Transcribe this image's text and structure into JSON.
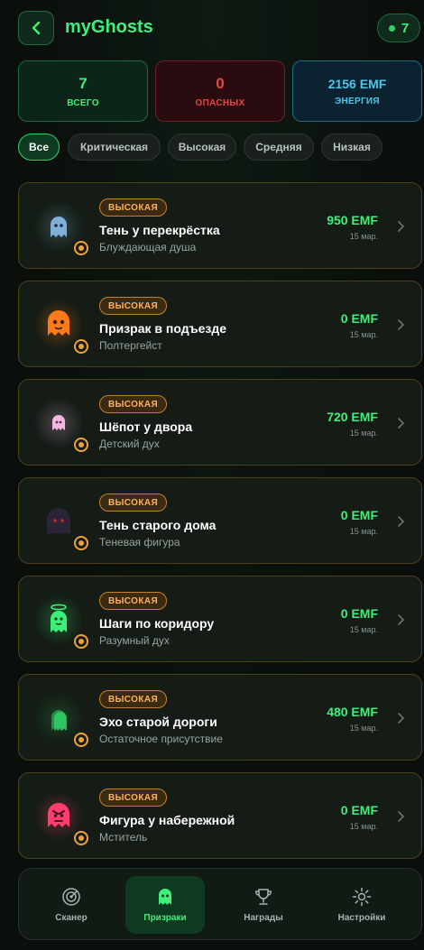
{
  "header": {
    "back_icon": "chevron-left-icon",
    "title": "myGhosts",
    "count": "7"
  },
  "stats": {
    "total": {
      "value": "7",
      "label": "ВСЕГО"
    },
    "danger": {
      "value": "0",
      "label": "ОПАСНЫХ"
    },
    "energy": {
      "value": "2156 EMF",
      "label": "ЭНЕРГИЯ"
    }
  },
  "filters": [
    "Все",
    "Критическая",
    "Высокая",
    "Средняя",
    "Низкая"
  ],
  "active_filter": "Все",
  "ghosts": [
    {
      "badge": "ВЫСОКАЯ",
      "title": "Тень у перекрёстка",
      "type": "Блуждающая душа",
      "emf": "950 EMF",
      "date": "15 мар.",
      "color": "#7fb0d8"
    },
    {
      "badge": "ВЫСОКАЯ",
      "title": "Призрак в подъезде",
      "type": "Полтергейст",
      "emf": "0 EMF",
      "date": "15 мар.",
      "color": "#ff7a1a"
    },
    {
      "badge": "ВЫСОКАЯ",
      "title": "Шёпот у двора",
      "type": "Детский дух",
      "emf": "720 EMF",
      "date": "15 мар.",
      "color": "#f2b8e0"
    },
    {
      "badge": "ВЫСОКАЯ",
      "title": "Тень старого дома",
      "type": "Теневая фигура",
      "emf": "0 EMF",
      "date": "15 мар.",
      "color": "#2a2436"
    },
    {
      "badge": "ВЫСОКАЯ",
      "title": "Шаги по коридору",
      "type": "Разумный дух",
      "emf": "0 EMF",
      "date": "15 мар.",
      "color": "#3ef07a"
    },
    {
      "badge": "ВЫСОКАЯ",
      "title": "Эхо старой дороги",
      "type": "Остаточное присутствие",
      "emf": "480 EMF",
      "date": "15 мар.",
      "color": "#2fd466"
    },
    {
      "badge": "ВЫСОКАЯ",
      "title": "Фигура у набережной",
      "type": "Мститель",
      "emf": "0 EMF",
      "date": "15 мар.",
      "color": "#ff3d6e"
    }
  ],
  "nav": [
    {
      "label": "Сканер",
      "icon": "radar-icon"
    },
    {
      "label": "Призраки",
      "icon": "ghost-icon"
    },
    {
      "label": "Награды",
      "icon": "trophy-icon"
    },
    {
      "label": "Настройки",
      "icon": "settings-icon"
    }
  ],
  "colors": {
    "accent": "#3ef07a",
    "danger": "#e04848",
    "energy": "#4cc6ea",
    "badge": "#ffb05a"
  }
}
